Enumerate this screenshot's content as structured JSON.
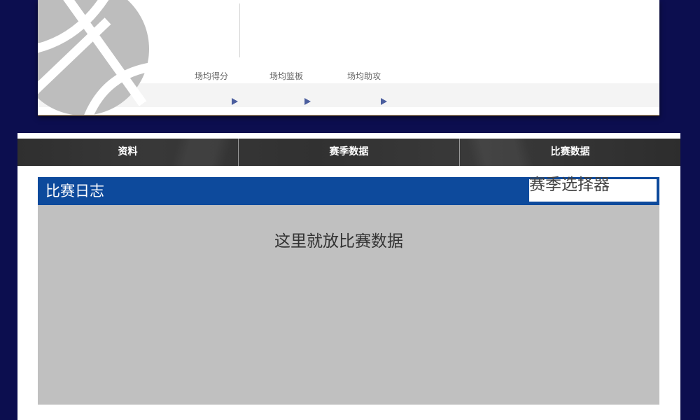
{
  "colors": {
    "page_background": "#0c0e4f",
    "header_blue": "#0d4a9c",
    "tab_bar": "#353535",
    "content_grey": "#c0c0c0",
    "triangle_icon": "#4b5e9e"
  },
  "player_card": {
    "logo_icon": "basketball-icon",
    "stats": [
      {
        "label": "场均得分",
        "icon": "triangle-right-icon"
      },
      {
        "label": "场均篮板",
        "icon": "triangle-right-icon"
      },
      {
        "label": "场均助攻",
        "icon": "triangle-right-icon"
      }
    ]
  },
  "tabs": [
    {
      "label": "资料"
    },
    {
      "label": "赛季数据"
    },
    {
      "label": "比赛数据"
    }
  ],
  "game_log": {
    "title": "比赛日志",
    "season_selector": "赛季选择器",
    "content_placeholder": "这里就放比赛数据"
  }
}
